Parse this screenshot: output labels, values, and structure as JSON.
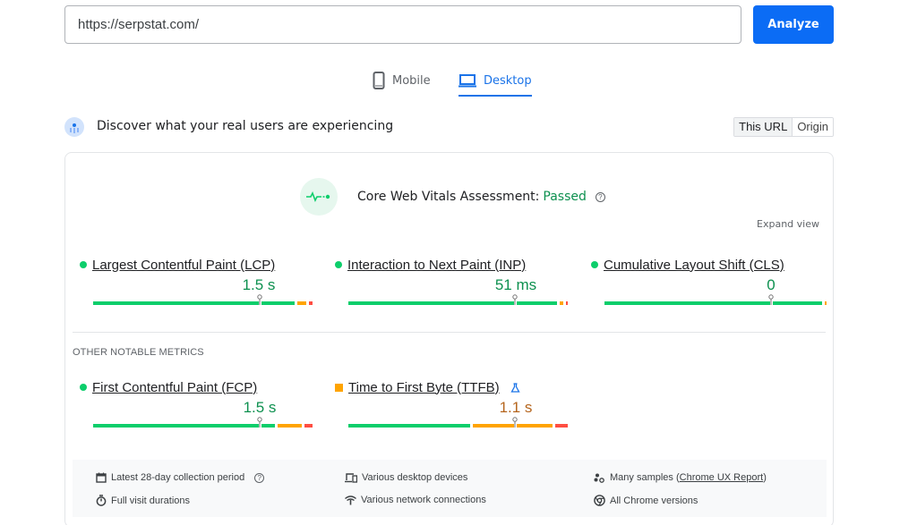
{
  "url_bar": {
    "value": "https://serpstat.com/",
    "analyze_label": "Analyze"
  },
  "device_tabs": [
    {
      "label": "Mobile",
      "icon": "smartphone-icon",
      "active": false
    },
    {
      "label": "Desktop",
      "icon": "laptop-icon",
      "active": true
    }
  ],
  "section": {
    "title": "Discover what your real users are experiencing",
    "icon": "crux-users-icon",
    "scope_toggle": [
      {
        "label": "This URL",
        "active": true
      },
      {
        "label": "Origin",
        "active": false
      }
    ]
  },
  "assessment": {
    "label": "Core Web Vitals Assessment: ",
    "status": "Passed",
    "status_color": "#0d904f",
    "help": "?",
    "expand_label": "Expand view"
  },
  "core_metrics": [
    {
      "name": "Largest Contentful Paint (LCP)",
      "value": "1.5 s",
      "rating": "good",
      "distribution": {
        "good": 0.92,
        "needs_improvement": 0.05,
        "poor": 0.03
      },
      "marker": 0.75
    },
    {
      "name": "Interaction to Next Paint (INP)",
      "value": "51 ms",
      "rating": "good",
      "distribution": {
        "good": 0.95,
        "needs_improvement": 0.03,
        "poor": 0.02
      },
      "marker": 0.75
    },
    {
      "name": "Cumulative Layout Shift (CLS)",
      "value": "0",
      "rating": "good",
      "distribution": {
        "good": 0.99,
        "needs_improvement": 0.01,
        "poor": 0.0
      },
      "marker": 0.75
    }
  ],
  "other_metrics_label": "OTHER NOTABLE METRICS",
  "other_metrics": [
    {
      "name": "First Contentful Paint (FCP)",
      "value": "1.5 s",
      "rating": "good",
      "distribution": {
        "good": 0.83,
        "needs_improvement": 0.12,
        "poor": 0.05
      },
      "marker": 0.75,
      "experimental": false
    },
    {
      "name": "Time to First Byte (TTFB)",
      "value": "1.1 s",
      "rating": "needs-improvement",
      "distribution": {
        "good": 0.56,
        "needs_improvement": 0.37,
        "poor": 0.07
      },
      "marker": 0.75,
      "experimental": true
    }
  ],
  "colors": {
    "good": "#0cce6b",
    "needs_improvement": "#ffa400",
    "poor": "#ff4e42",
    "accent": "#1a73e8",
    "button": "#0b6cf5"
  },
  "footer": [
    {
      "icon": "calendar-icon",
      "text": "Latest 28-day collection period",
      "help": "?"
    },
    {
      "icon": "timer-icon",
      "text": "Full visit durations"
    },
    {
      "icon": "devices-icon",
      "text": "Various desktop devices"
    },
    {
      "icon": "network-icon",
      "text": "Various network connections"
    },
    {
      "icon": "samples-icon",
      "text_before": "Many samples (",
      "link": "Chrome UX Report",
      "text_after": ")"
    },
    {
      "icon": "chrome-icon",
      "text": "All Chrome versions"
    }
  ]
}
